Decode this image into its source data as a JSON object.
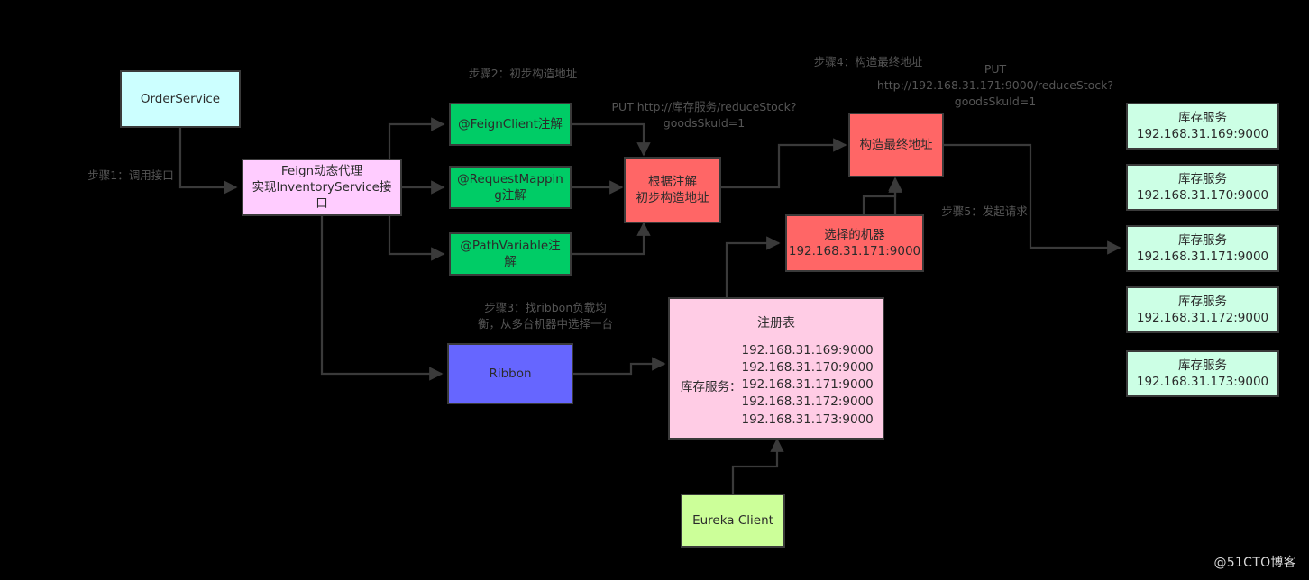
{
  "diagram": {
    "background": "#000000",
    "wire_color": "#3a3a3a",
    "label_color": "#555555",
    "watermark": "@51CTO博客"
  },
  "nodes": {
    "order_service": {
      "label": "OrderService",
      "color": "#CCFFFF"
    },
    "feign_proxy": {
      "label": "Feign动态代理\n实现InventoryService接口",
      "color": "#FFCCFF"
    },
    "feign_client_annotation": {
      "label": "@FeignClient注解",
      "color": "#00CC66"
    },
    "request_mapping_annotation": {
      "label": "@RequestMappin\ng注解",
      "color": "#00CC66"
    },
    "path_variable_annotation": {
      "label": "@PathVariable注\n解",
      "color": "#00CC66"
    },
    "build_initial_address": {
      "label": "根据注解\n初步构造地址",
      "color": "#FF6666"
    },
    "build_final_address": {
      "label": "构造最终地址",
      "color": "#FF6666"
    },
    "selected_machine": {
      "label": "选择的机器\n192.168.31.171:9000",
      "color": "#FF6666"
    },
    "ribbon": {
      "label": "Ribbon",
      "color": "#6666FF"
    },
    "eureka_client": {
      "label": "Eureka Client",
      "color": "#CCFF99"
    }
  },
  "registry": {
    "title": "注册表",
    "key": "库存服务：",
    "color": "#FFCCE5",
    "entries": [
      "192.168.31.169:9000",
      "192.168.31.170:9000",
      "192.168.31.171:9000",
      "192.168.31.172:9000",
      "192.168.31.173:9000"
    ]
  },
  "instances": {
    "color": "#CCFFE5",
    "title": "库存服务",
    "items": [
      {
        "title": "库存服务",
        "address": "192.168.31.169:9000"
      },
      {
        "title": "库存服务",
        "address": "192.168.31.170:9000"
      },
      {
        "title": "库存服务",
        "address": "192.168.31.171:9000"
      },
      {
        "title": "库存服务",
        "address": "192.168.31.172:9000"
      },
      {
        "title": "库存服务",
        "address": "192.168.31.173:9000"
      }
    ]
  },
  "annotations": {
    "step1": "步骤1：调用接口",
    "step2": "步骤2：初步构造地址",
    "step3": "步骤3：找ribbon负载均\n衡，从多台机器中选择一台",
    "step4": "步骤4：构造最终地址",
    "step5": "步骤5：发起请求",
    "put_initial": "PUT http://库存服务/reduceStock?\ngoodsSkuId=1",
    "put_final": "PUT\nhttp://192.168.31.171:9000/reduceStock?\ngoodsSkuId=1"
  }
}
